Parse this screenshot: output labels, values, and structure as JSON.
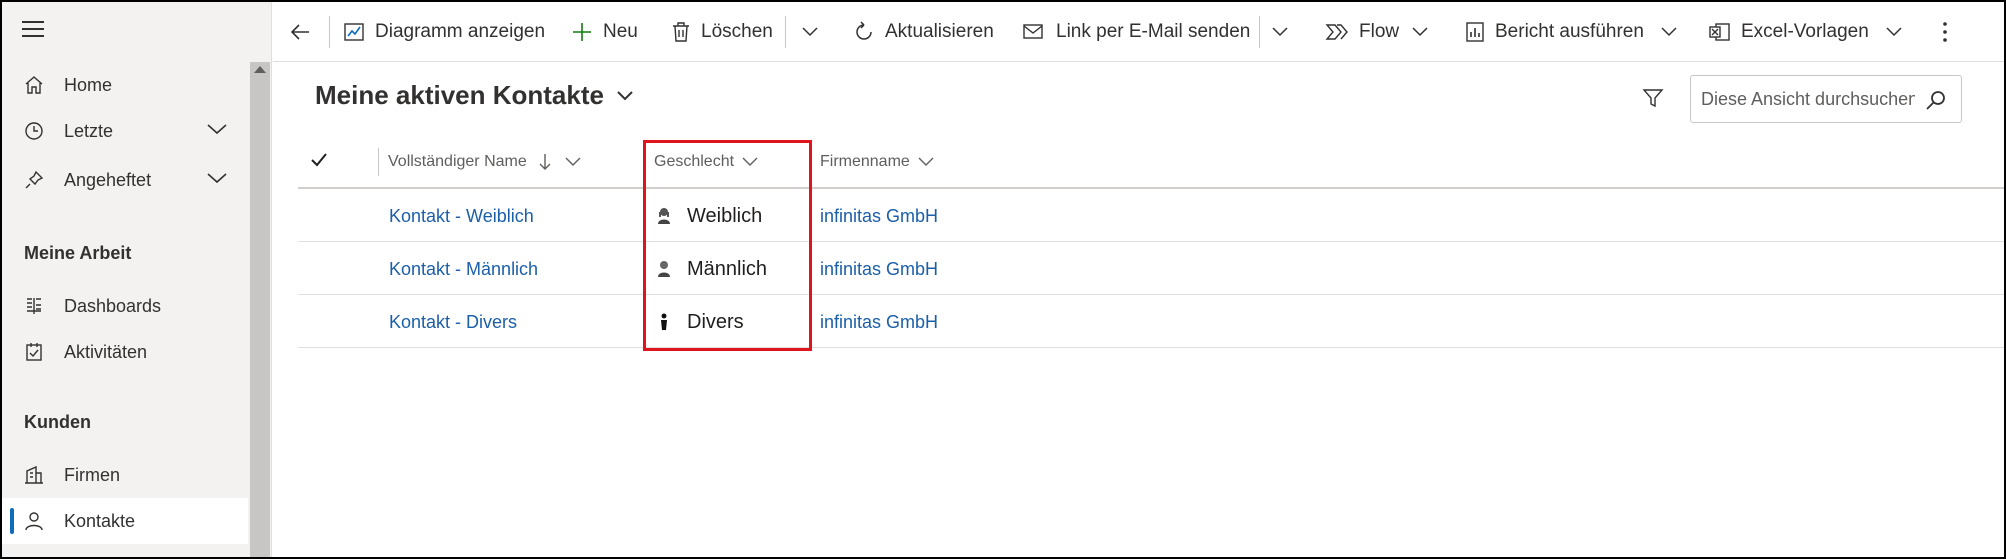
{
  "sidebar": {
    "items_top": [
      {
        "label": "Home",
        "icon": "home-icon"
      },
      {
        "label": "Letzte",
        "icon": "clock-icon"
      },
      {
        "label": "Angeheftet",
        "icon": "pin-icon"
      }
    ],
    "section_meine_arbeit": "Meine Arbeit",
    "items_arbeit": [
      {
        "label": "Dashboards",
        "icon": "dashboard-icon"
      },
      {
        "label": "Aktivitäten",
        "icon": "activities-icon"
      }
    ],
    "section_kunden": "Kunden",
    "items_kunden": [
      {
        "label": "Firmen",
        "icon": "building-icon"
      },
      {
        "label": "Kontakte",
        "icon": "person-icon",
        "selected": true
      }
    ]
  },
  "toolbar": {
    "diagramm": "Diagramm anzeigen",
    "neu": "Neu",
    "loeschen": "Löschen",
    "aktualisieren": "Aktualisieren",
    "link_email": "Link per E-Mail senden",
    "flow": "Flow",
    "bericht": "Bericht ausführen",
    "excel": "Excel-Vorlagen"
  },
  "view": {
    "title": "Meine aktiven Kontakte",
    "search_placeholder": "Diese Ansicht durchsuchen"
  },
  "columns": {
    "name": "Vollständiger Name",
    "geschlecht": "Geschlecht",
    "firma": "Firmenname"
  },
  "rows": [
    {
      "name": "Kontakt - Weiblich",
      "geschlecht": "Weiblich",
      "gender_icon": "female-icon",
      "firma": "infinitas GmbH"
    },
    {
      "name": "Kontakt - Männlich",
      "geschlecht": "Männlich",
      "gender_icon": "male-icon",
      "firma": "infinitas GmbH"
    },
    {
      "name": "Kontakt - Divers",
      "geschlecht": "Divers",
      "gender_icon": "diverse-icon",
      "firma": "infinitas GmbH"
    }
  ],
  "colors": {
    "accent": "#0f6cbd",
    "link": "#1b5fa8",
    "highlight": "#e0141c",
    "sidebar_bg": "#f3f2f1"
  }
}
